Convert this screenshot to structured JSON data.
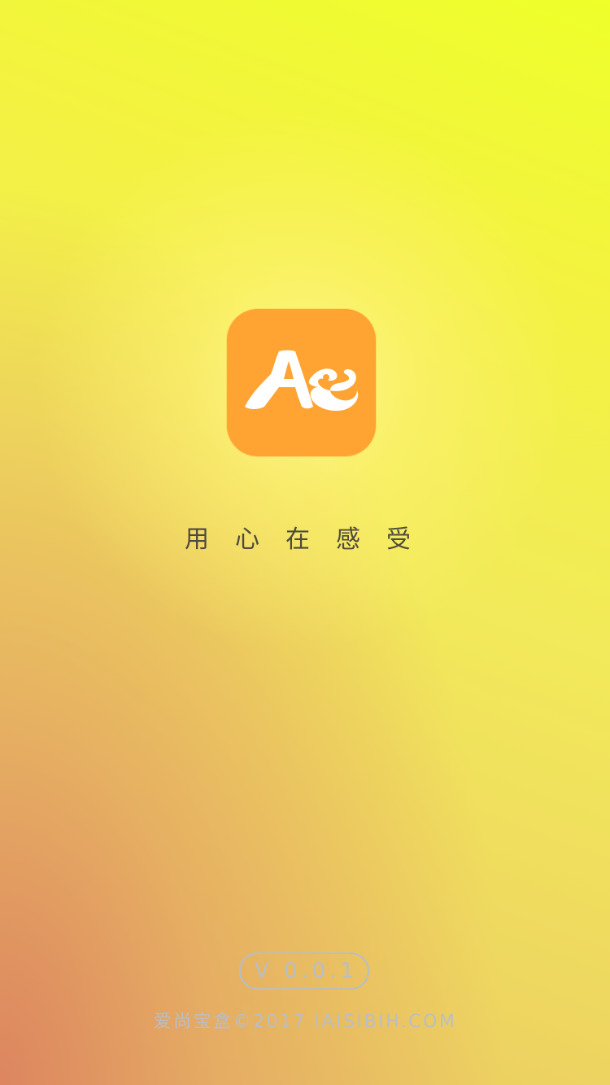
{
  "splash": {
    "logo_text": "As",
    "slogan": "用心在感受",
    "version": "V 0.0.1",
    "copyright": "爱尚宝盒©2017 IAISIBIH.COM"
  },
  "colors": {
    "logo_background": "#ffa333",
    "logo_glyph": "#ffffff",
    "slogan_text": "#4d4a3e",
    "footer_text": "#b7bec6",
    "background_top_right": "#eeff2a",
    "background_bottom_left": "#dc825f"
  },
  "icons": {
    "app_logo": "as-monogram-icon"
  }
}
